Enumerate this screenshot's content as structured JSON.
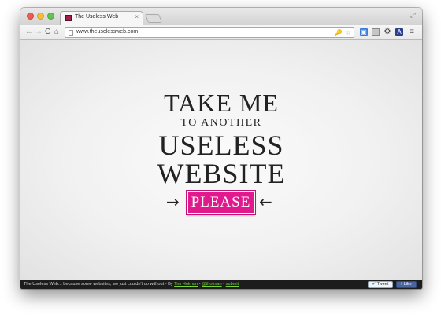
{
  "browser": {
    "tab_title": "The Useless Web",
    "tab_close": "×",
    "url": "www.theuselessweb.com",
    "nav": {
      "back": "←",
      "forward": "→",
      "reload": "C",
      "home": "⌂"
    },
    "omnibox_icons": [
      "key-icon",
      "star-icon"
    ],
    "extension_icons": [
      "screen-capture-icon",
      "page-icon",
      "gear-icon",
      "dictionary-icon",
      "menu-icon"
    ],
    "menu_glyph": "≡",
    "fullscreen_glyph": "⤢"
  },
  "page": {
    "line1": "TAKE ME",
    "line2": "TO ANOTHER",
    "line3": "USELESS",
    "line4": "WEBSITE",
    "arrow_left": "→",
    "arrow_right": "←",
    "button_label": "PLEASE",
    "accent_color": "#e0198d"
  },
  "footer": {
    "text_prefix": "The Useless Web... because some websites, we just couldn't do without - By ",
    "author_link": "Tim Holman",
    "separator1": " - ",
    "twitter_link": "@tholman",
    "separator2": " - ",
    "submit_link": "submit",
    "tweet_label": "Tweet",
    "like_label": "Like"
  }
}
